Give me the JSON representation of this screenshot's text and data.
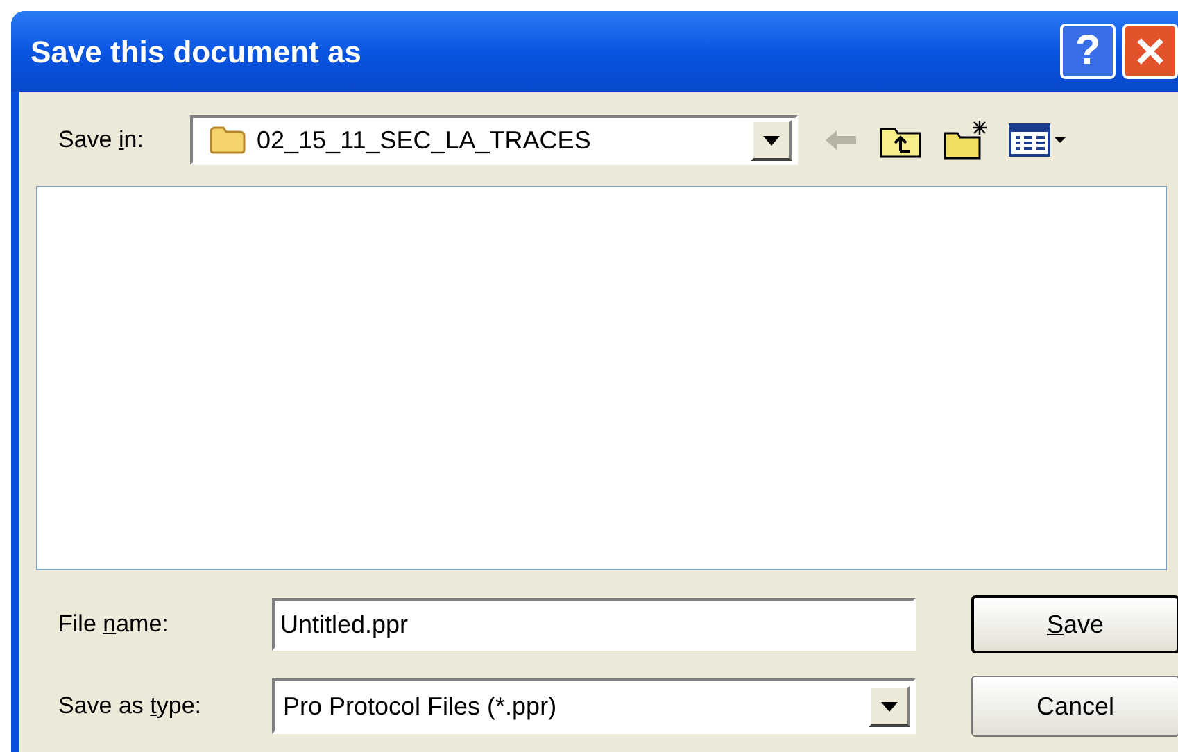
{
  "window": {
    "title": "Save this document as"
  },
  "title_buttons": [
    {
      "kind": "help",
      "label": "?"
    },
    {
      "kind": "close"
    }
  ],
  "save_in": {
    "label": {
      "before": "Save ",
      "key": "i",
      "after": "n:"
    },
    "value": "02_15_11_SEC_LA_TRACES"
  },
  "toolbar": [
    {
      "kind": "back",
      "disabled": true
    },
    {
      "kind": "up",
      "disabled": false
    },
    {
      "kind": "new-folder",
      "disabled": false
    },
    {
      "kind": "view-menu",
      "disabled": false
    }
  ],
  "file_name": {
    "label": {
      "before": "File ",
      "key": "n",
      "after": "ame:"
    },
    "value": "Untitled.ppr"
  },
  "save_as_type": {
    "label": {
      "before": "Save as ",
      "key": "t",
      "after": "ype:"
    },
    "value": "Pro Protocol Files (*.ppr)"
  },
  "buttons": [
    {
      "kind": "default",
      "label": {
        "key": "S",
        "after": "ave"
      }
    },
    {
      "kind": "normal",
      "label": {
        "before": "Cancel"
      }
    }
  ]
}
